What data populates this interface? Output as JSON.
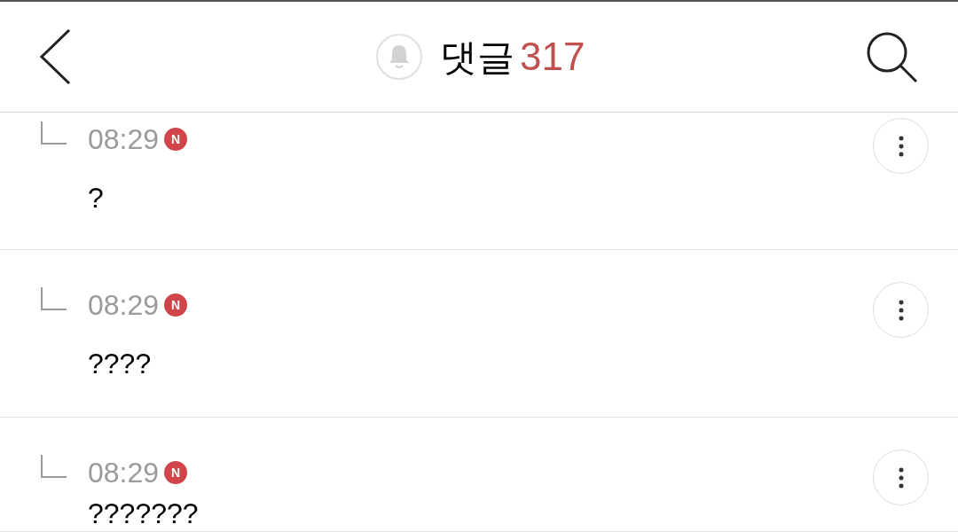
{
  "header": {
    "title": "댓글",
    "count": "317"
  },
  "comments": [
    {
      "time": "08:29",
      "badge": "N",
      "text": "?"
    },
    {
      "time": "08:29",
      "badge": "N",
      "text": "????"
    },
    {
      "time": "08:29",
      "badge": "N",
      "text": "???????"
    }
  ]
}
